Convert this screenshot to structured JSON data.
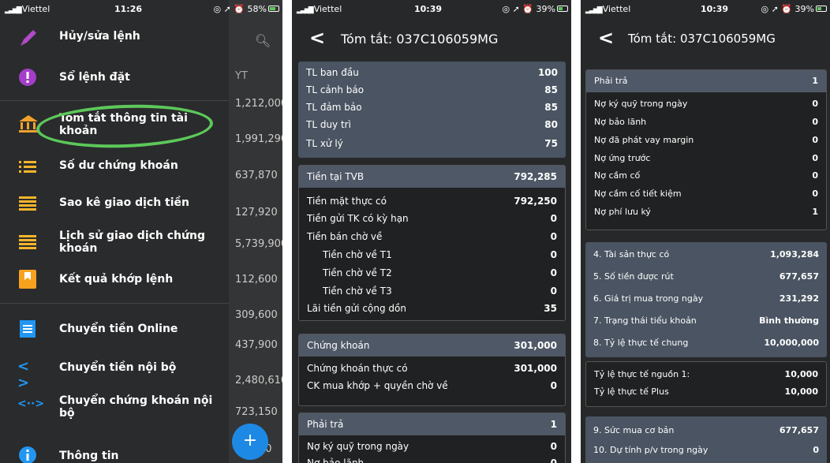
{
  "panel1": {
    "status": {
      "carrier": "Viettel",
      "time": "11:26",
      "battery": "58%"
    },
    "header_col": "YT",
    "values": [
      "1,212,000",
      "1,991,290",
      "637,870",
      "127,920",
      "5,739,900",
      "112,600",
      "309,600",
      "437,900",
      "2,480,610",
      "723,150",
      "70"
    ],
    "menu": [
      {
        "label": "Hủy/sửa lệnh",
        "icon": "pencil-icon"
      },
      {
        "label": "Sổ lệnh đặt",
        "icon": "alert-icon"
      },
      {
        "label": "Tóm tắt thông tin tài khoản",
        "icon": "bank-icon"
      },
      {
        "label": "Số dư chứng khoán",
        "icon": "list-icon"
      },
      {
        "label": "Sao kê giao dịch tiền",
        "icon": "lines-icon"
      },
      {
        "label": "Lịch sử giao dịch chứng khoán",
        "icon": "lines-icon"
      },
      {
        "label": "Kết quả khớp lệnh",
        "icon": "bookmark-icon"
      },
      {
        "label": "Chuyển tiền Online",
        "icon": "receipt-icon"
      },
      {
        "label": "Chuyển tiền nội bộ",
        "icon": "code-icon"
      },
      {
        "label": "Chuyển chứng khoán nội bộ",
        "icon": "transfer-icon"
      },
      {
        "label": "Thông tin",
        "icon": "info-icon"
      }
    ],
    "fab": "+"
  },
  "panel2": {
    "status": {
      "carrier": "Viettel",
      "time": "10:39",
      "battery": "39%"
    },
    "title": "Tóm tắt: 037C106059MG",
    "ratios": [
      [
        "TL ban đầu",
        "100"
      ],
      [
        "TL cảnh báo",
        "85"
      ],
      [
        "TL đảm bảo",
        "85"
      ],
      [
        "TL duy trì",
        "80"
      ],
      [
        "TL xử lý",
        "75"
      ]
    ],
    "cash_hdr": [
      "Tiền tại TVB",
      "792,285"
    ],
    "cash": [
      [
        "Tiền mặt thực có",
        "792,250"
      ],
      [
        "Tiền gửi TK có kỳ hạn",
        "0"
      ],
      [
        "Tiền bán chờ về",
        "0"
      ],
      [
        "Tiền chờ về  T1",
        "0"
      ],
      [
        "Tiền chờ về  T2",
        "0"
      ],
      [
        "Tiền chờ về  T3",
        "0"
      ],
      [
        "Lãi tiền gửi cộng dồn",
        "35"
      ]
    ],
    "sec_hdr": [
      "Chứng khoán",
      "301,000"
    ],
    "sec": [
      [
        "Chứng khoán thực có",
        "301,000"
      ],
      [
        "CK mua khớp + quyền chờ về",
        "0"
      ]
    ],
    "pay_hdr": [
      "Phải trả",
      "1"
    ],
    "pay": [
      [
        "Nợ ký quỹ trong ngày",
        "0"
      ],
      [
        "Nợ bảo lãnh",
        "0"
      ]
    ]
  },
  "panel3": {
    "status": {
      "carrier": "Viettel",
      "time": "10:39",
      "battery": "39%"
    },
    "title": "Tóm tắt: 037C106059MG",
    "pay_hdr": [
      "Phải trả",
      "1"
    ],
    "pay": [
      [
        "Nợ ký quỹ trong ngày",
        "0"
      ],
      [
        "Nợ bảo lãnh",
        "0"
      ],
      [
        "Nợ đã phát vay margin",
        "0"
      ],
      [
        "Nợ ứng trước",
        "0"
      ],
      [
        "Nợ cầm cố",
        "0"
      ],
      [
        "Nợ cầm cố tiết kiệm",
        "0"
      ],
      [
        "Nợ phí lưu ký",
        "1"
      ]
    ],
    "sum": [
      [
        "4. Tài sản thực có",
        "1,093,284"
      ],
      [
        "5. Số tiền được rút",
        "677,657"
      ],
      [
        "6. Giá trị mua trong ngày",
        "231,292"
      ],
      [
        "7. Trạng thái tiểu khoản",
        "Bình thường"
      ],
      [
        "8. Tỷ lệ thực tế chung",
        "10,000,000"
      ]
    ],
    "ratio": [
      [
        "Tỷ lệ thực tế nguồn 1:",
        "10,000"
      ],
      [
        "Tỷ lệ thực tế Plus",
        "10,000"
      ]
    ],
    "buy": [
      [
        "9. Sức mua cơ bản",
        "677,657"
      ],
      [
        "10. Dự tính p/v trong ngày",
        "0"
      ]
    ]
  }
}
